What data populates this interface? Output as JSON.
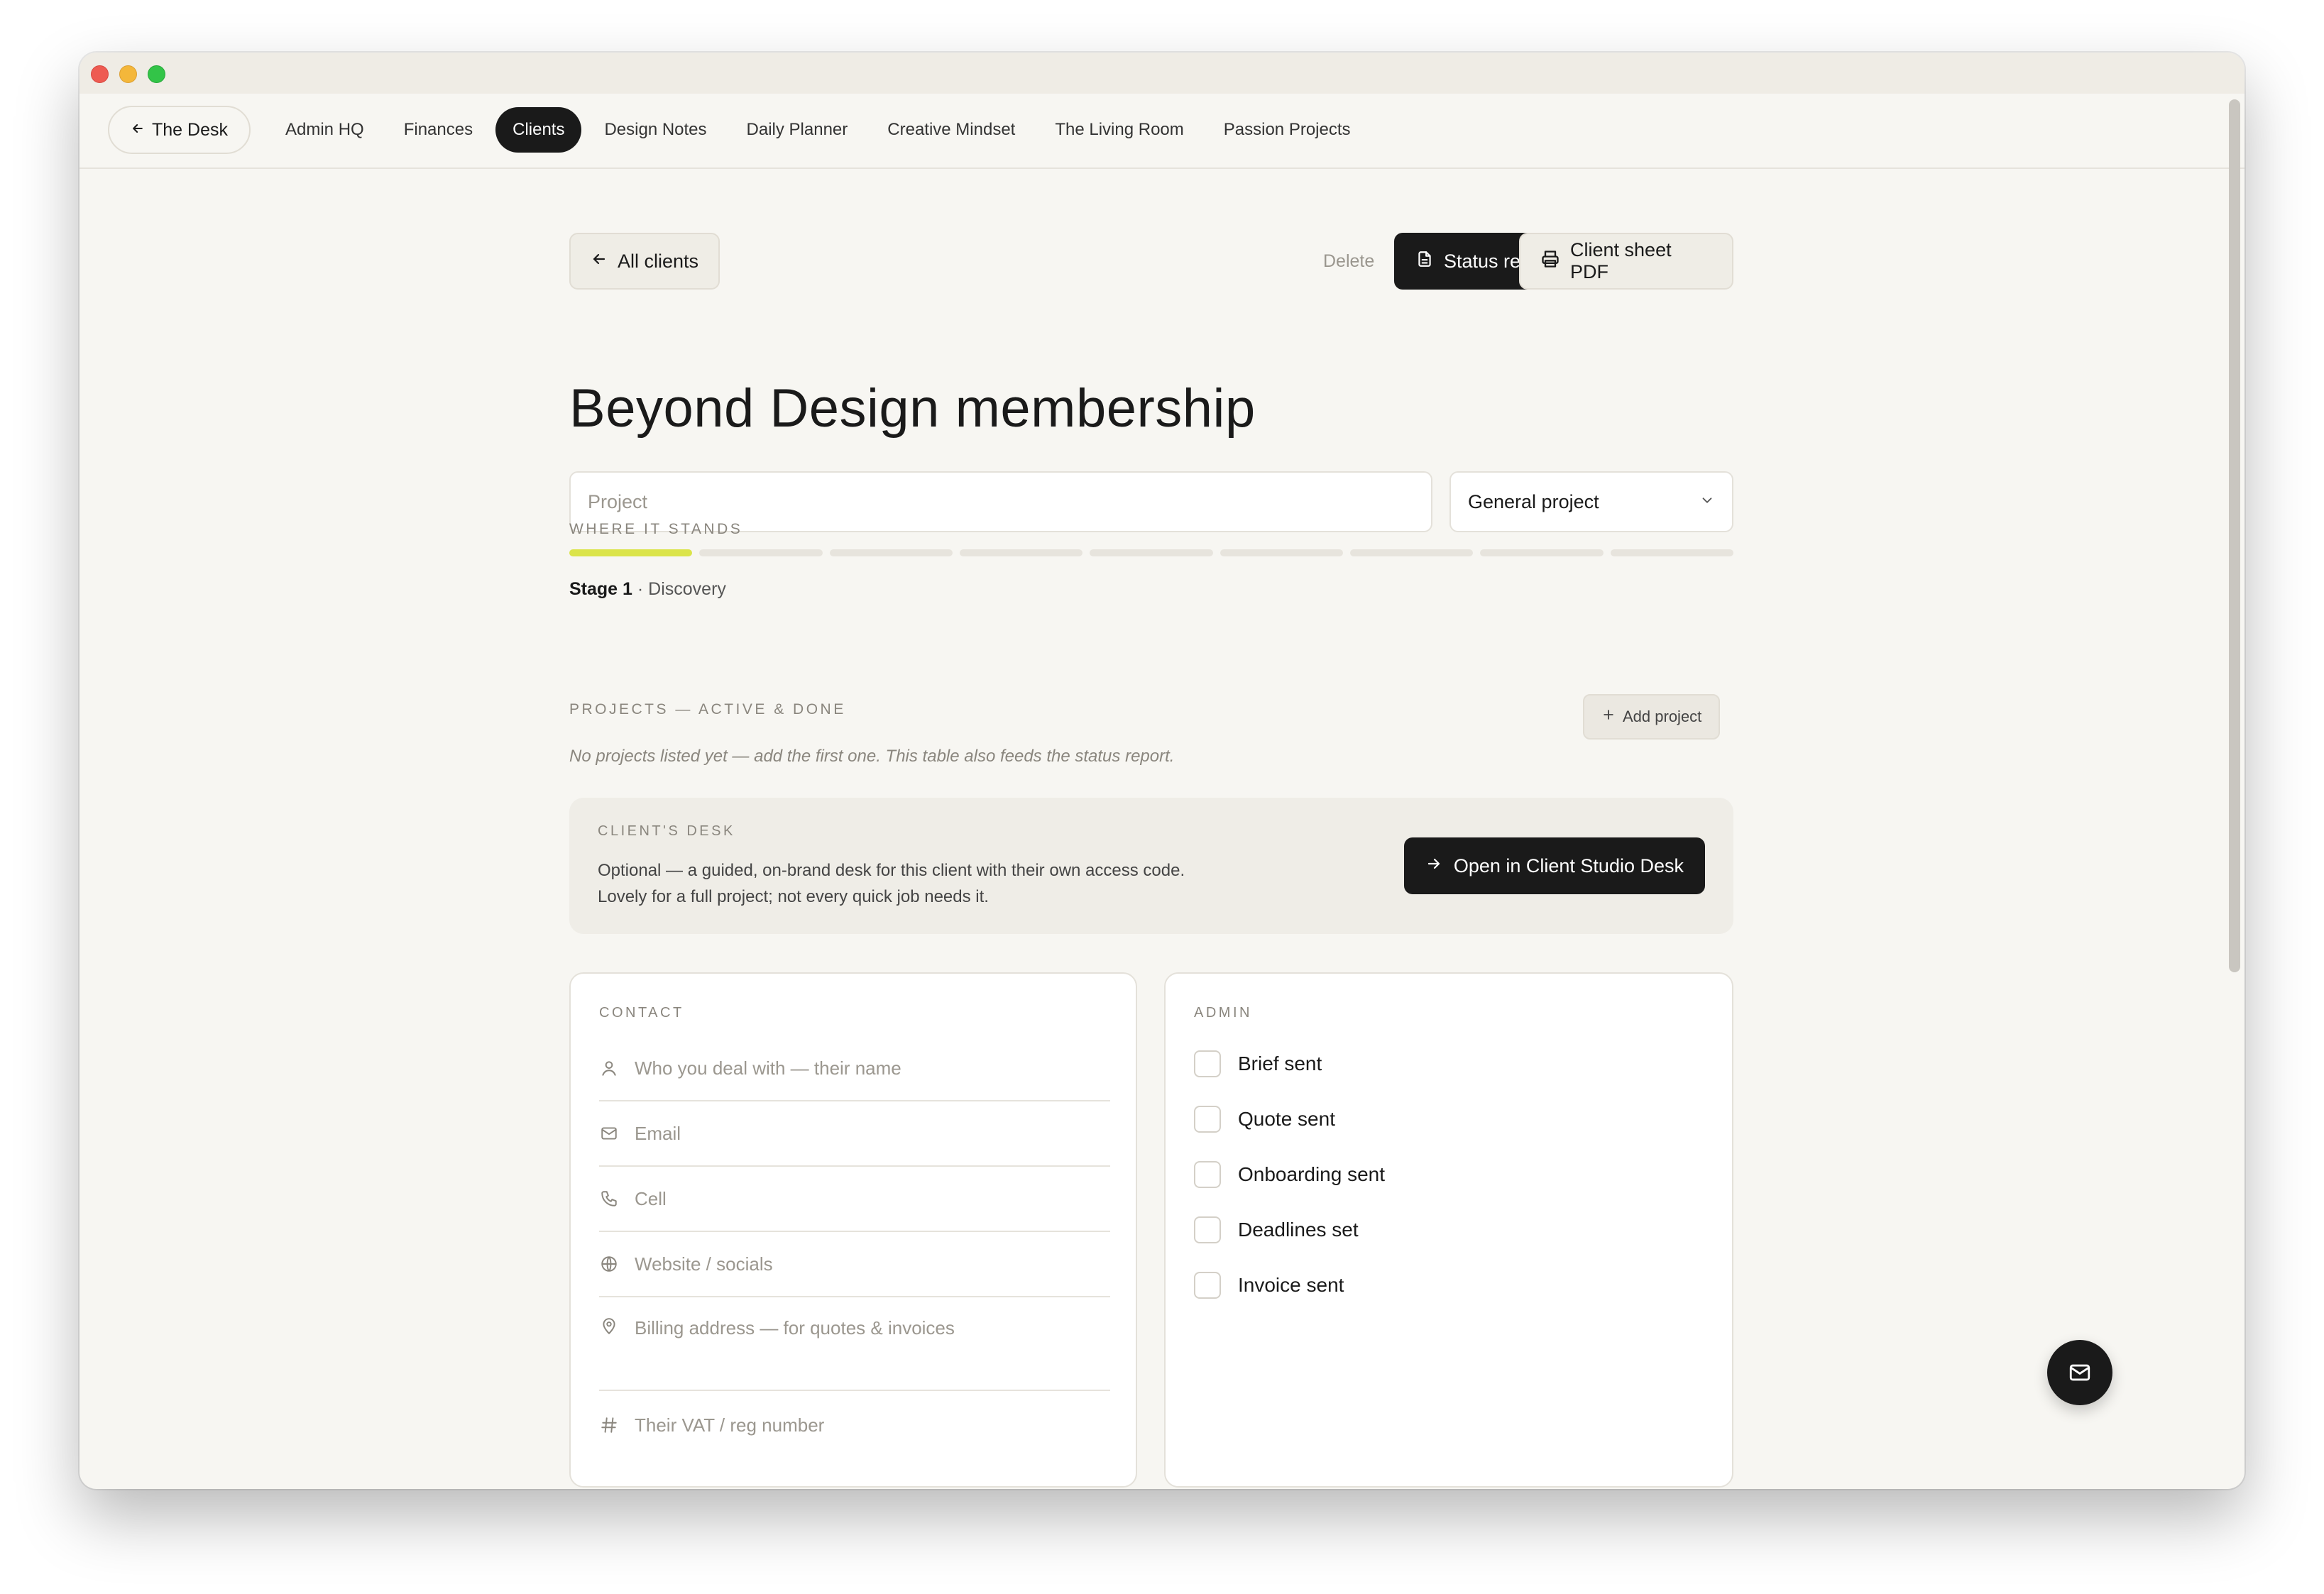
{
  "nav": {
    "back_label": "The Desk",
    "tabs": [
      {
        "label": "Admin HQ",
        "active": false
      },
      {
        "label": "Finances",
        "active": false
      },
      {
        "label": "Clients",
        "active": true
      },
      {
        "label": "Design Notes",
        "active": false
      },
      {
        "label": "Daily Planner",
        "active": false
      },
      {
        "label": "Creative Mindset",
        "active": false
      },
      {
        "label": "The Living Room",
        "active": false
      },
      {
        "label": "Passion Projects",
        "active": false
      }
    ]
  },
  "toolbar": {
    "all_clients_label": "All clients",
    "delete_label": "Delete",
    "status_report_label": "Status report",
    "client_sheet_label": "Client sheet PDF"
  },
  "page": {
    "title": "Beyond Design membership",
    "project_placeholder": "Project",
    "project_type": "General project"
  },
  "progress": {
    "label": "WHERE IT STANDS",
    "total_stages": 9,
    "current_stage": 1,
    "stage_word": "Stage 1",
    "stage_name": "· Discovery",
    "accent_color": "#dbe44a"
  },
  "projects": {
    "label": "PROJECTS — ACTIVE & DONE",
    "add_label": "Add project",
    "empty_note": "No projects listed yet — add the first one. This table also feeds the status report."
  },
  "client_desk": {
    "label": "CLIENT'S DESK",
    "line1": "Optional — a guided, on-brand desk for this client with their own access code.",
    "line2": "Lovely for a full project; not every quick job needs it.",
    "button_label": "Open in Client Studio Desk"
  },
  "contact": {
    "label": "CONTACT",
    "fields": [
      {
        "icon": "person-icon",
        "placeholder": "Who you deal with — their name"
      },
      {
        "icon": "mail-icon",
        "placeholder": "Email"
      },
      {
        "icon": "phone-icon",
        "placeholder": "Cell"
      },
      {
        "icon": "globe-icon",
        "placeholder": "Website / socials"
      },
      {
        "icon": "location-pin-icon",
        "placeholder": "Billing address — for quotes & invoices"
      },
      {
        "icon": "hash-icon",
        "placeholder": "Their VAT / reg number"
      }
    ]
  },
  "admin": {
    "label": "ADMIN",
    "items": [
      {
        "label": "Brief sent",
        "checked": false
      },
      {
        "label": "Quote sent",
        "checked": false
      },
      {
        "label": "Onboarding sent",
        "checked": false
      },
      {
        "label": "Deadlines set",
        "checked": false
      },
      {
        "label": "Invoice sent",
        "checked": false
      }
    ]
  }
}
